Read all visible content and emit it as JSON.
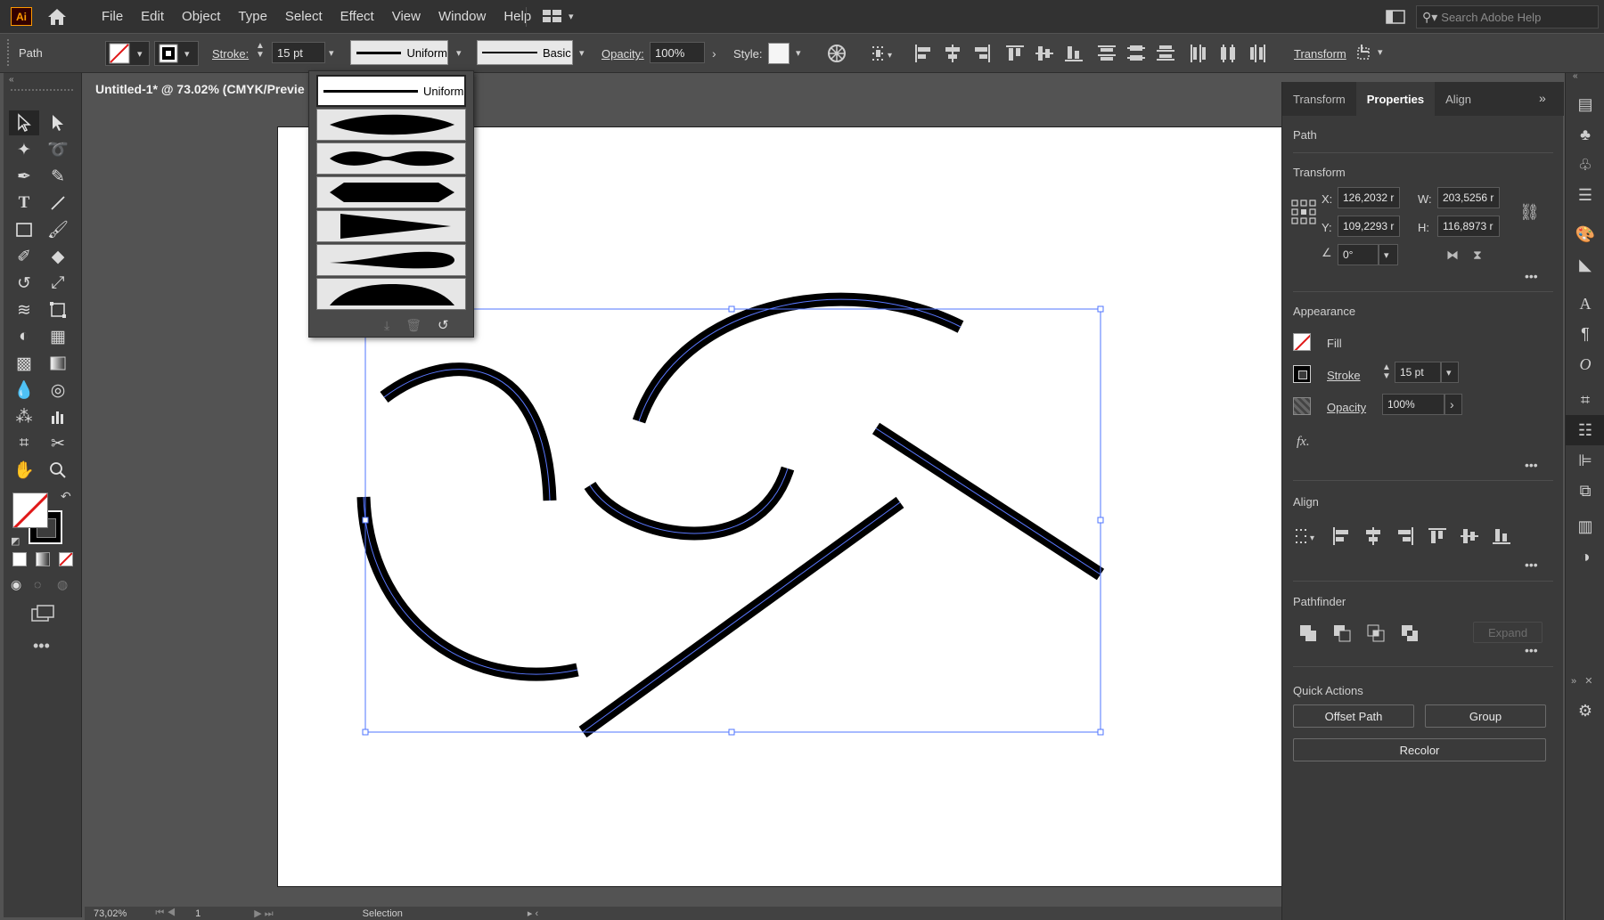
{
  "app": {
    "logo": "Ai"
  },
  "menu": [
    "File",
    "Edit",
    "Object",
    "Type",
    "Select",
    "Effect",
    "View",
    "Window",
    "Help"
  ],
  "search": {
    "placeholder": "Search Adobe Help"
  },
  "control": {
    "selection_label": "Path",
    "stroke_label": "Stroke:",
    "stroke_value": "15 pt",
    "profile_label": "Uniform",
    "brush_label": "Basic",
    "opacity_label": "Opacity:",
    "opacity_value": "100%",
    "style_label": "Style:",
    "transform_label": "Transform"
  },
  "document": {
    "tab_title": "Untitled-1* @ 73.02% (CMYK/Previe"
  },
  "profile_popup": {
    "selected_label": "Uniform"
  },
  "panel": {
    "tabs": [
      "Transform",
      "Properties",
      "Align"
    ],
    "active_tab": "Properties",
    "object_type": "Path",
    "transform": {
      "title": "Transform",
      "x_label": "X:",
      "x_value": "126,2032 r",
      "y_label": "Y:",
      "y_value": "109,2293 r",
      "w_label": "W:",
      "w_value": "203,5256 r",
      "h_label": "H:",
      "h_value": "116,8973 r",
      "angle_value": "0°"
    },
    "appearance": {
      "title": "Appearance",
      "fill_label": "Fill",
      "stroke_label": "Stroke",
      "stroke_value": "15 pt",
      "opacity_label": "Opacity",
      "opacity_value": "100%",
      "fx_label": "fx."
    },
    "align": {
      "title": "Align"
    },
    "pathfinder": {
      "title": "Pathfinder",
      "expand_label": "Expand"
    },
    "quick_actions": {
      "title": "Quick Actions",
      "offset_path": "Offset Path",
      "group": "Group",
      "recolor": "Recolor"
    }
  },
  "status": {
    "zoom": "73,02%",
    "artboard": "1",
    "mode": "Selection"
  }
}
